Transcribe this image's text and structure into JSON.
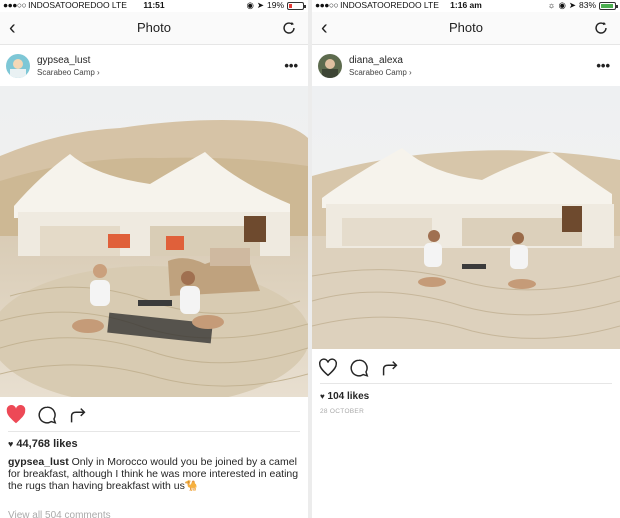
{
  "left": {
    "status": {
      "carrier": "INDOSATOOREDOO  LTE",
      "time": "11:51",
      "battery": "19%"
    },
    "nav": {
      "title": "Photo"
    },
    "post": {
      "username": "gypsea_lust",
      "location": "Scarabeo Camp",
      "likes": "44,768 likes",
      "caption_user": "gypsea_lust",
      "caption_text": "Only in Morocco would you be joined by a camel for breakfast, although I think he was more interested in eating the rugs than having breakfast with us🐪",
      "view_all": "View all 504 comments"
    },
    "colors": {
      "battery": "#e53935",
      "heart": "#ed4956"
    }
  },
  "right": {
    "status": {
      "carrier": "INDOSATOOREDOO  LTE",
      "time": "1:16 am",
      "battery": "83%"
    },
    "nav": {
      "title": "Photo"
    },
    "post": {
      "username": "diana_alexa",
      "location": "Scarabeo Camp",
      "likes": "104 likes",
      "date": "28 OCTOBER"
    },
    "colors": {
      "battery": "#4caf50"
    }
  }
}
